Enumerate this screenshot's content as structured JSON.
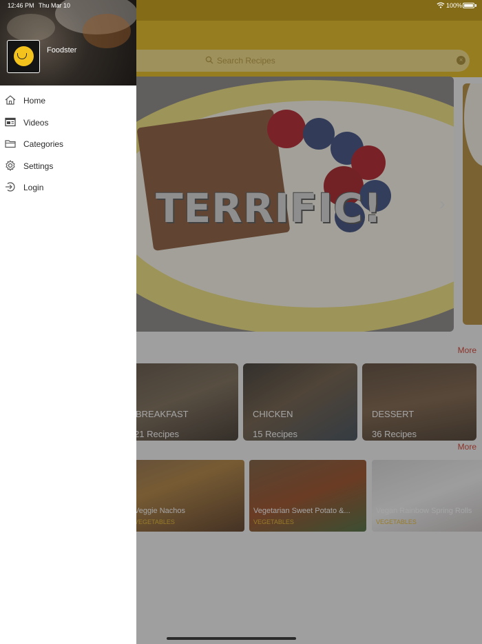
{
  "status_bar": {
    "time": "12:46 PM",
    "date": "Thu Mar 10",
    "battery": "100%"
  },
  "drawer": {
    "app_name": "Foodster",
    "logo_text": "FOODSTER",
    "items": [
      {
        "label": "Home",
        "icon": "home-icon"
      },
      {
        "label": "Videos",
        "icon": "video-icon"
      },
      {
        "label": "Categories",
        "icon": "folder-icon"
      },
      {
        "label": "Settings",
        "icon": "gear-icon"
      },
      {
        "label": "Login",
        "icon": "login-icon"
      }
    ]
  },
  "search": {
    "placeholder": "Search Recipes"
  },
  "hero": {
    "overlay_text": "TERRIFIC!"
  },
  "categories": {
    "more_label": "More",
    "items": [
      {
        "name": "BREAKFAST",
        "count": "21 Recipes"
      },
      {
        "name": "CHICKEN",
        "count": "15 Recipes"
      },
      {
        "name": "DESSERT",
        "count": "36 Recipes"
      }
    ]
  },
  "recipes": {
    "more_label": "More",
    "items": [
      {
        "title": "Veggie Nachos",
        "tag": "VEGETABLES"
      },
      {
        "title": "Vegetarian Sweet Potato &...",
        "tag": "VEGETABLES"
      },
      {
        "title": "Vegan Rainbow Spring Rolls",
        "tag": "VEGETABLES"
      }
    ]
  },
  "colors": {
    "brand_yellow": "#e6ba1a",
    "link_red": "#d23a2a",
    "tag_gold": "#e8b92b"
  }
}
